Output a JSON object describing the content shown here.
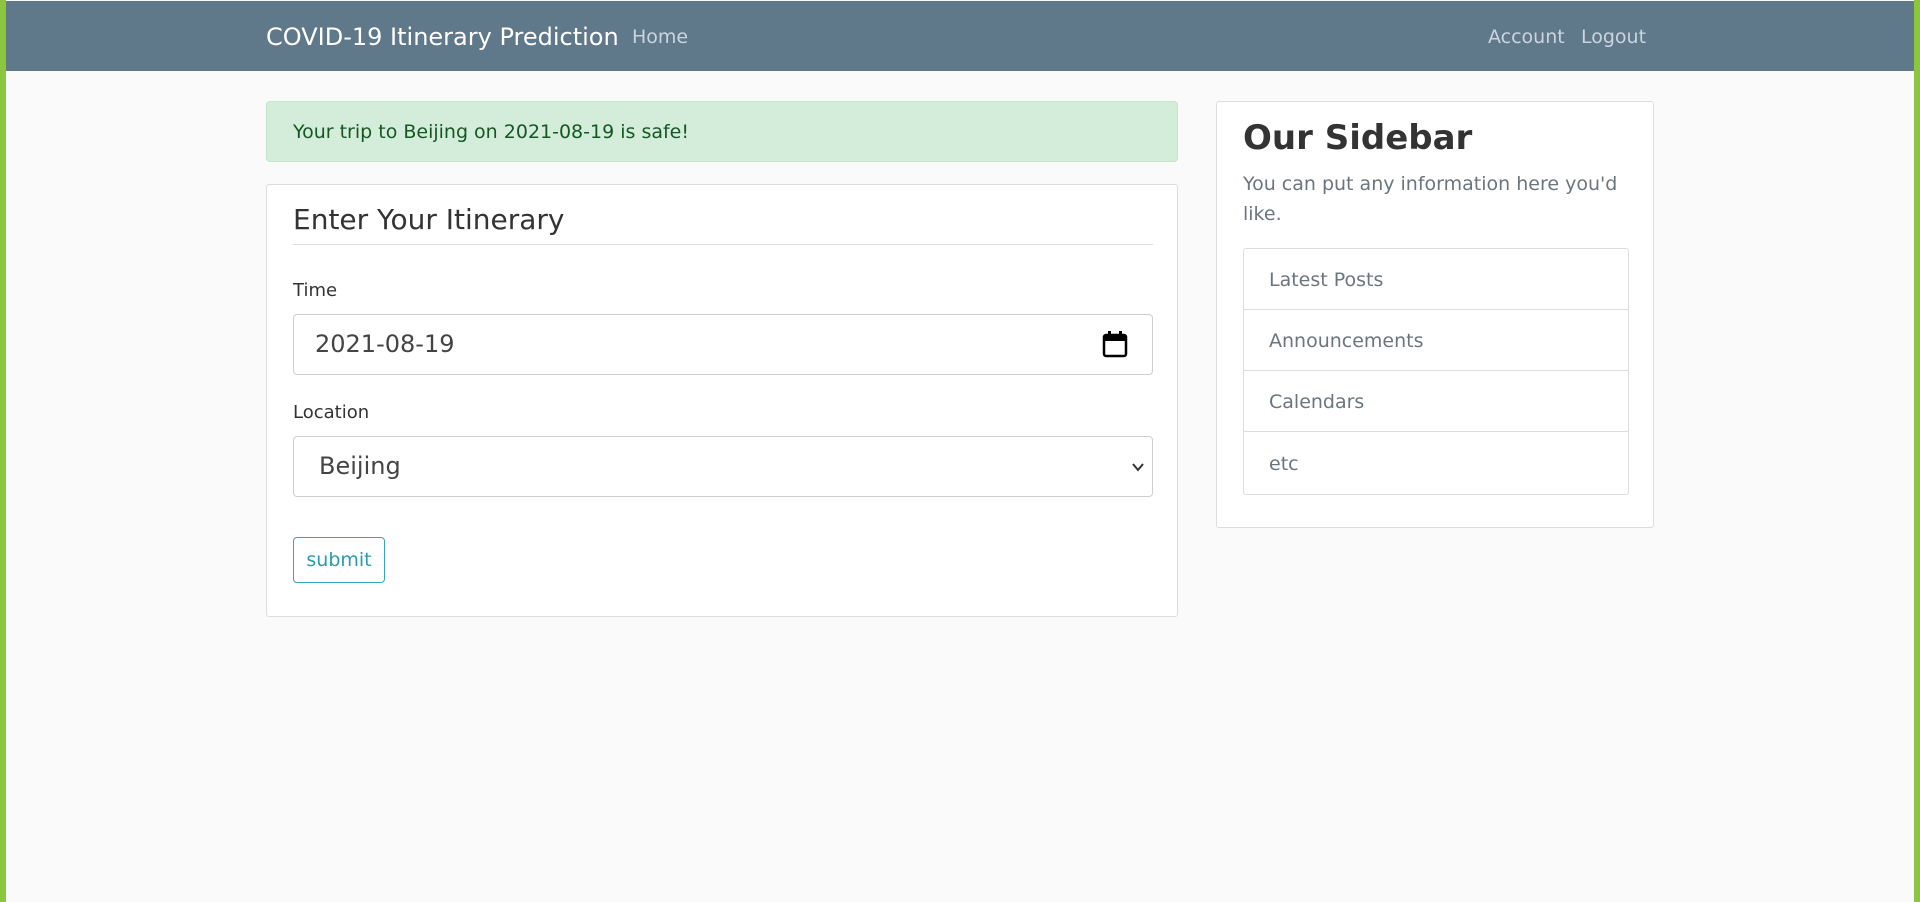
{
  "navbar": {
    "brand": "COVID-19 Itinerary Prediction",
    "home": "Home",
    "account": "Account",
    "logout": "Logout"
  },
  "alert": {
    "message": "Your trip to Beijing on 2021-08-19 is safe!"
  },
  "form": {
    "legend": "Enter Your Itinerary",
    "time_label": "Time",
    "time_value": "2021-08-19",
    "location_label": "Location",
    "location_value": "Beijing",
    "submit_label": "submit"
  },
  "sidebar": {
    "title": "Our Sidebar",
    "text": "You can put any information here you'd like.",
    "items": [
      {
        "label": "Latest Posts"
      },
      {
        "label": "Announcements"
      },
      {
        "label": "Calendars"
      },
      {
        "label": "etc"
      }
    ]
  },
  "colors": {
    "navbar": "#5f788a",
    "alert_bg": "#d4edda",
    "alert_text": "#155724",
    "accent": "#2a9aaf",
    "page_edge": "#8cc63f"
  }
}
